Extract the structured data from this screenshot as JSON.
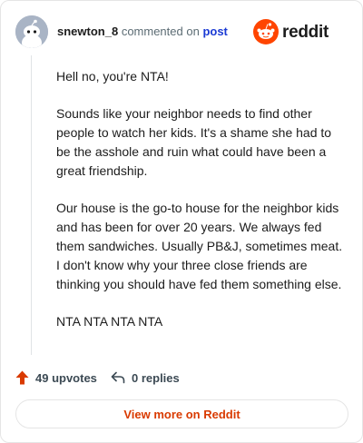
{
  "header": {
    "username": "snewton_8",
    "commented_on": "commented on",
    "post_link": "post",
    "logo_text": "reddit"
  },
  "comment": {
    "paragraphs": [
      "Hell no, you're NTA!",
      "Sounds like your neighbor needs to find other people to watch her kids. It's a shame she had to be the asshole and ruin what could have been a great friendship.",
      "Our house is the go-to house for the neighbor kids and has been for over 20 years. We always fed them sandwiches. Usually PB&J, sometimes meat. I don't know why your three close friends are thinking you should have fed them something else.",
      "NTA NTA NTA NTA"
    ]
  },
  "actions": {
    "upvotes": "49 upvotes",
    "replies": "0 replies"
  },
  "footer": {
    "view_more": "View more on Reddit"
  },
  "colors": {
    "brand": "#ff4500",
    "upvote": "#d93a00",
    "link": "#1a3ad4",
    "view_more": "#d93a00"
  },
  "icons": {
    "avatar": "snoo-avatar-icon",
    "logo": "reddit-logo-icon",
    "upvote": "upvote-arrow-icon",
    "reply": "reply-arrow-icon"
  }
}
